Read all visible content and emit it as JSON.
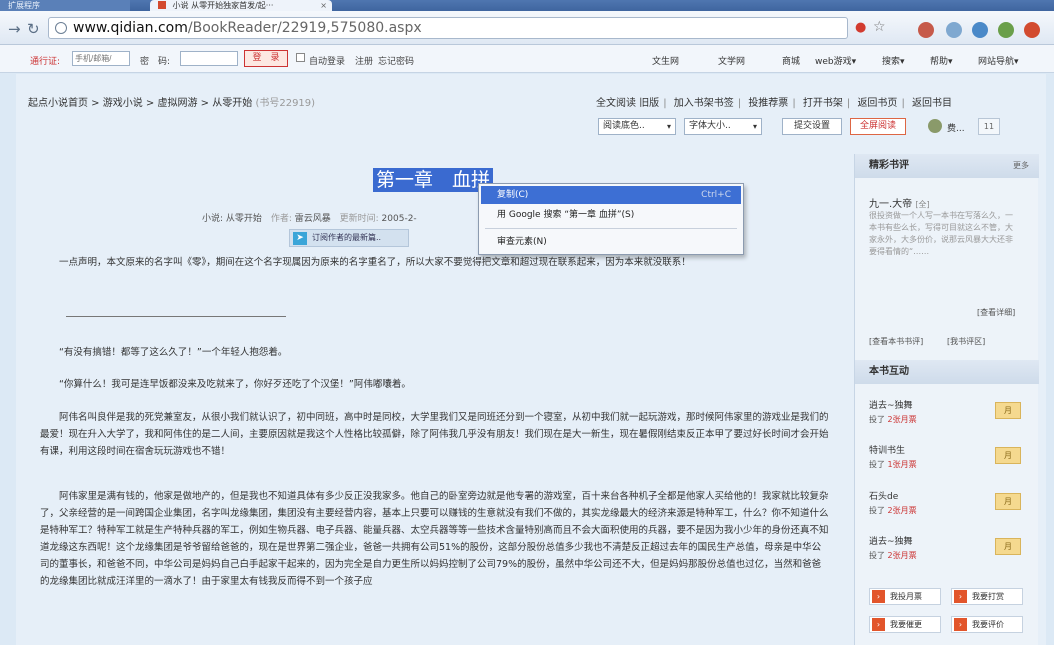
{
  "browser": {
    "tabs": [
      {
        "label": "扩展程序",
        "active": false
      },
      {
        "label": "小说 从零开始独家首发/起···",
        "active": true
      }
    ],
    "url_host": "www.qidian.com",
    "url_path": "/BookReader/22919,575080.aspx"
  },
  "sitebar": {
    "pass_label": "通行证:",
    "user_placeholder": "手机/邮箱/",
    "password_label": "密　码:",
    "login_button": "登　录",
    "auto_login": "自动登录",
    "register": "注册",
    "forgot": "忘记密码",
    "links": [
      "文生网",
      "文学网",
      "商城",
      "web游戏▾",
      "搜索▾",
      "帮助▾",
      "网站导航▾"
    ]
  },
  "breadcrumb": {
    "items": [
      "起点小说首页",
      "游戏小说",
      "虚拟网游",
      "从零开始"
    ],
    "book_no": "(书号22919)"
  },
  "toplinks": [
    "全文阅读",
    "旧版",
    "加入书架书签",
    "投推荐票",
    "打开书架",
    "返回书页",
    "返回书目"
  ],
  "reader_controls": {
    "bg_color_select": "阅读底色..",
    "font_size_select": "字体大小..",
    "submit_button": "提交设置",
    "fullscreen_button": "全屏阅读",
    "gold_label": "费...",
    "small_box": "11"
  },
  "chapter": {
    "title": "第一章　血拼",
    "meta_book_label": "小说:",
    "meta_book": "从零开始",
    "meta_author_label": "作者:",
    "meta_author": "雷云风暴",
    "meta_time_label": "更新时间:",
    "meta_time": "2005-2-",
    "related_button": "订阅作者的最新篇..",
    "paragraphs": [
      "一点声明，本文原来的名字叫《零》，期间在这个名字现属因为原来的名字重名了，所以大家不要觉得把文章和超过现在联系起来，因为本来就没联系！",
      "“有没有搞错！都等了这么久了！”一个年轻人抱怨着。",
      "“你算什么！我可是连早饭都没来及吃就来了，你好歹还吃了个汉堡！”阿伟嘟囔着。",
      "阿伟名叫良伴是我的死党兼室友，从很小我们就认识了，初中同班，高中时是同校，大学里我们又是同班还分到一个寝室，从初中我们就一起玩游戏，那时候阿伟家里的游戏业是我们的最爱！现在升入大学了，我和阿伟住的是二人间，主要原因就是我这个人性格比较孤僻，除了阿伟我几乎没有朋友！我们现在是大一新生，现在暑假刚结束反正本甲了要过好长时间才会开始有课，利用这段时间在宿舍玩玩游戏也不错！",
      "阿伟家里是满有钱的，他家是做地产的，但是我也不知道具体有多少反正没我家多。他自己的卧室旁边就是他专署的游戏室，百十来台各种机子全都是他家人买给他的！我家就比较复杂了，父亲经营的是一间跨国企业集团，名字叫龙缘集团，集团没有主要经营内容，基本上只要可以赚钱的生意就没有我们不做的，其实龙缘最大的经济来源是特种军工，什么？你不知道什么是特种军工？特种军工就是生产特种兵器的军工，例如生物兵器、电子兵器、能量兵器、太空兵器等等一些技术含量特别高而且不会大面积使用的兵器，要不是因为我小少年的身份还真不知道龙缘这东西呢！这个龙缘集团是爷爷留给爸爸的，现在是世界第二强企业，爸爸一共拥有公司51%的股份，这部分股份总值多少我也不清楚反正超过去年的国民生产总值，母亲是中华公司的董事长，和爸爸不同，中华公司是妈妈自己白手起家干起来的，因为完全是自力更生所以妈妈控制了公司79%的股份，虽然中华公司还不大，但是妈妈那股份总值也过亿，当然和爸爸的龙缘集团比就成汪洋里的一滴水了！由于家里太有钱我反而得不到一个孩子应"
    ]
  },
  "context_menu": {
    "items": [
      {
        "label": "复制(C)",
        "shortcut": "Ctrl+C"
      },
      {
        "label": "用 Google 搜索 “第一章 血拼”(S)",
        "shortcut": ""
      },
      {
        "label": "审查元素(N)",
        "shortcut": ""
      }
    ]
  },
  "sidebar": {
    "reviews_header": "精彩书评",
    "reviews_more": "更多",
    "review_title": "九一.大帝",
    "review_tag": "[全]",
    "review_body": "很投资做一个人写一本书在写落么久，一本书有些么长，写得可目就这么不管，大家永外，大多份价，说那云风暴大大还非要得看情的“……",
    "review_detail": "[查看详细]",
    "review_view_all": "[查看本书书评]",
    "review_my": "[我书评区]",
    "interaction_header": "本书互动",
    "fans": [
      {
        "name": "逍去~独舞",
        "action": "投了",
        "votes": "2张月票"
      },
      {
        "name": "特训书生",
        "action": "投了",
        "votes": "1张月票"
      },
      {
        "name": "石头de",
        "action": "投了",
        "votes": "2张月票"
      },
      {
        "name": "逍去~独舞",
        "action": "投了",
        "votes": "2张月票"
      }
    ],
    "vote_label": "月",
    "action_buttons": [
      "我投月票",
      "我要打赏",
      "我要催更",
      "我要评价"
    ]
  }
}
